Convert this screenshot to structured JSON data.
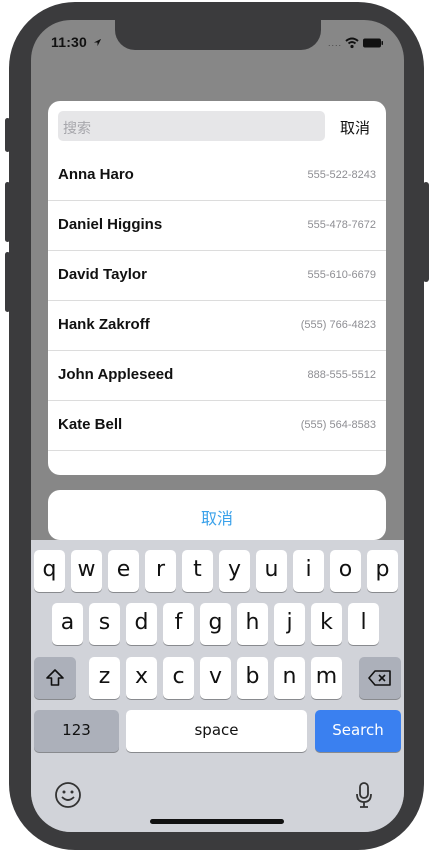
{
  "status_bar": {
    "time": "11:30"
  },
  "picker": {
    "search_placeholder": "搜索",
    "cancel_label": "取消",
    "contacts": [
      {
        "name": "Anna Haro",
        "phone": "555-522-8243"
      },
      {
        "name": "Daniel Higgins",
        "phone": "555-478-7672"
      },
      {
        "name": "David Taylor",
        "phone": "555-610-6679"
      },
      {
        "name": "Hank Zakroff",
        "phone": "(555) 766-4823"
      },
      {
        "name": "John Appleseed",
        "phone": "888-555-5512"
      },
      {
        "name": "Kate Bell",
        "phone": "(555) 564-8583"
      }
    ]
  },
  "action_sheet": {
    "cancel_label": "取消"
  },
  "keyboard": {
    "row1": [
      "q",
      "w",
      "e",
      "r",
      "t",
      "y",
      "u",
      "i",
      "o",
      "p"
    ],
    "row2": [
      "a",
      "s",
      "d",
      "f",
      "g",
      "h",
      "j",
      "k",
      "l"
    ],
    "row3": [
      "z",
      "x",
      "c",
      "v",
      "b",
      "n",
      "m"
    ],
    "numbers_label": "123",
    "space_label": "space",
    "search_label": "Search",
    "icons": [
      "shift-icon",
      "backspace-icon",
      "emoji-icon",
      "microphone-icon"
    ]
  },
  "colors": {
    "accent": "#3aa1ea",
    "search_key": "#3a80f0",
    "frame": "#3b3b3d",
    "dim_overlay": "#878787"
  }
}
